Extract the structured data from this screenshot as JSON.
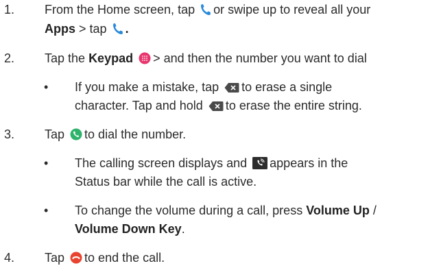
{
  "steps": [
    {
      "num": "1.",
      "line1_a": "From the Home screen, tap",
      "line1_b": "or swipe up to reveal all your",
      "apps_bold": "Apps",
      "line2_a": "> tap",
      "line2_end": "."
    },
    {
      "num": "2.",
      "tap": "Tap the",
      "keypad_bold": "Keypad",
      "rest": "> and then the number you want to dial",
      "bullet": {
        "mark": "•",
        "l1_a": "If you make a mistake, tap",
        "l1_b": "to erase a single",
        "l2_a": "character. Tap and hold",
        "l2_b": "to erase the entire string."
      }
    },
    {
      "num": "3.",
      "tap": "Tap",
      "rest": "to dial the number.",
      "bullets": [
        {
          "mark": "•",
          "l1_a": "The calling screen displays and",
          "l1_b": "appears in the",
          "l2": "Status bar while the call is active."
        },
        {
          "mark": "•",
          "l1_a": "To change the volume during a call, press",
          "l1_bold": "Volume Up",
          "l1_end": "/",
          "l2_bold": "Volume Down Key",
          "l2_end": "."
        }
      ]
    },
    {
      "num": "4.",
      "tap": "Tap",
      "rest": "to end the call."
    }
  ],
  "icons": {
    "phone": "phone-icon",
    "keypad": "keypad-icon",
    "backspace": "backspace-icon",
    "dial": "dial-call-icon",
    "status": "call-status-icon",
    "end": "end-call-icon"
  },
  "colors": {
    "phone_blue": "#2a8ad8",
    "keypad_pink": "#e8356e",
    "dial_green": "#2fb36b",
    "end_red": "#e8442f",
    "backspace_gray": "#4a4a4a"
  }
}
